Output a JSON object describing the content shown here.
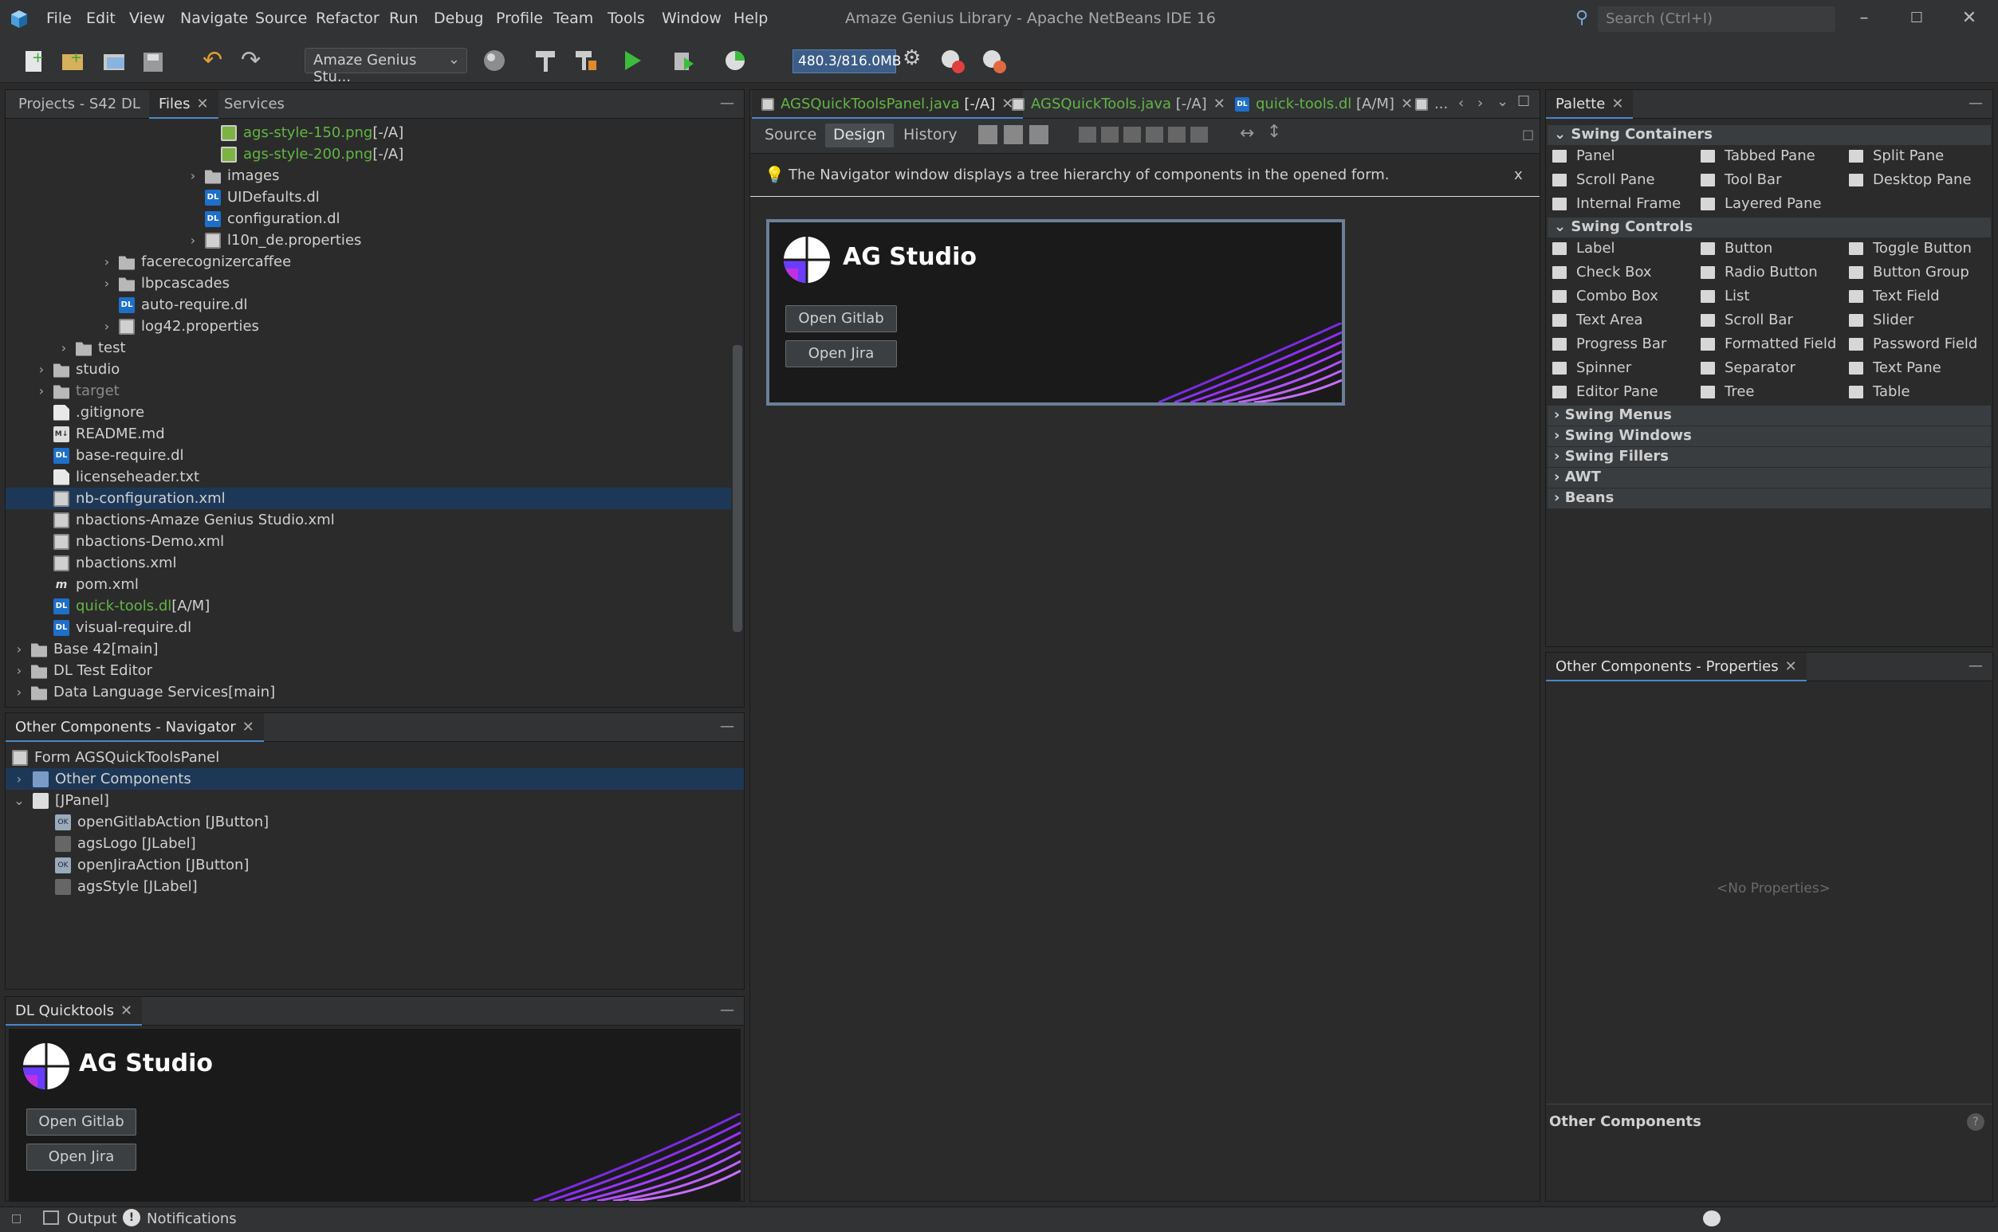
{
  "window": {
    "title": "Amaze Genius Library - Apache NetBeans IDE 16",
    "search_placeholder": "Search (Ctrl+I)"
  },
  "menu": [
    "File",
    "Edit",
    "View",
    "Navigate",
    "Source",
    "Refactor",
    "Run",
    "Debug",
    "Profile",
    "Team",
    "Tools",
    "Window",
    "Help"
  ],
  "toolbar": {
    "project_combo": "Amaze Genius Stu...",
    "memory": "480.3/816.0MB"
  },
  "left_panel": {
    "tabs": [
      "Projects - S42 DL",
      "Files",
      "Services"
    ],
    "tree": [
      {
        "label": "ags-style-150.png",
        "suffix": " [-/A]"
      },
      {
        "label": "ags-style-200.png",
        "suffix": " [-/A]"
      },
      {
        "label": "images",
        "suffix": ""
      },
      {
        "label": "UIDefaults.dl",
        "suffix": ""
      },
      {
        "label": "configuration.dl",
        "suffix": ""
      },
      {
        "label": "l10n_de.properties",
        "suffix": ""
      },
      {
        "label": "facerecognizercaffee",
        "suffix": ""
      },
      {
        "label": "lbpcascades",
        "suffix": ""
      },
      {
        "label": "auto-require.dl",
        "suffix": ""
      },
      {
        "label": "log42.properties",
        "suffix": ""
      },
      {
        "label": "test",
        "suffix": ""
      },
      {
        "label": "studio",
        "suffix": ""
      },
      {
        "label": "target",
        "suffix": ""
      },
      {
        "label": ".gitignore",
        "suffix": ""
      },
      {
        "label": "README.md",
        "suffix": ""
      },
      {
        "label": "base-require.dl",
        "suffix": ""
      },
      {
        "label": "licenseheader.txt",
        "suffix": ""
      },
      {
        "label": "nb-configuration.xml",
        "suffix": ""
      },
      {
        "label": "nbactions-Amaze Genius Studio.xml",
        "suffix": ""
      },
      {
        "label": "nbactions-Demo.xml",
        "suffix": ""
      },
      {
        "label": "nbactions.xml",
        "suffix": ""
      },
      {
        "label": "pom.xml",
        "suffix": ""
      },
      {
        "label": "quick-tools.dl",
        "suffix": " [A/M]"
      },
      {
        "label": "visual-require.dl",
        "suffix": ""
      },
      {
        "label": "Base 42",
        "suffix": " [main]"
      },
      {
        "label": "DL Test Editor",
        "suffix": ""
      },
      {
        "label": "Data Language Services",
        "suffix": " [main]"
      }
    ]
  },
  "navigator": {
    "tab": "Other Components - Navigator",
    "items": [
      "Form AGSQuickToolsPanel",
      "Other Components",
      "[JPanel]",
      "openGitlabAction [JButton]",
      "agsLogo [JLabel]",
      "openJiraAction [JButton]",
      "agsStyle [JLabel]"
    ]
  },
  "quicktools": {
    "tab": "DL Quicktools",
    "title": "AG Studio",
    "gitlab": "Open Gitlab",
    "jira": "Open Jira"
  },
  "editor": {
    "tabs": [
      {
        "label": "AGSQuickToolsPanel.java",
        "suffix": " [-/A]"
      },
      {
        "label": "AGSQuickTools.java",
        "suffix": " [-/A]"
      },
      {
        "label": "quick-tools.dl",
        "suffix": " [A/M]"
      }
    ],
    "overflow": "...",
    "modes": [
      "Source",
      "Design",
      "History"
    ],
    "hint": "The Navigator window displays a tree hierarchy of components in the opened form.",
    "hint_close": "x",
    "form_title": "AG Studio",
    "form_gitlab": "Open Gitlab",
    "form_jira": "Open Jira"
  },
  "palette": {
    "tab": "Palette",
    "categories": {
      "swing_containers": "Swing Containers",
      "swing_controls": "Swing Controls",
      "swing_menus": "Swing Menus",
      "swing_windows": "Swing Windows",
      "swing_fillers": "Swing Fillers",
      "awt": "AWT",
      "beans": "Beans"
    },
    "containers": [
      "Panel",
      "Tabbed Pane",
      "Split Pane",
      "Scroll Pane",
      "Tool Bar",
      "Desktop Pane",
      "Internal Frame",
      "Layered Pane"
    ],
    "controls": [
      "Label",
      "Button",
      "Toggle Button",
      "Check Box",
      "Radio Button",
      "Button Group",
      "Combo Box",
      "List",
      "Text Field",
      "Text Area",
      "Scroll Bar",
      "Slider",
      "Progress Bar",
      "Formatted Field",
      "Password Field",
      "Spinner",
      "Separator",
      "Text Pane",
      "Editor Pane",
      "Tree",
      "Table"
    ]
  },
  "properties": {
    "tab": "Other Components - Properties",
    "empty": "<No Properties>",
    "footer": "Other Components"
  },
  "status": {
    "output": "Output",
    "notifications": "Notifications"
  },
  "colors": {
    "accent": "#4a88c7",
    "selection": "#1d3857",
    "vcs_green": "#62b543",
    "purple": "#9b30ff"
  }
}
